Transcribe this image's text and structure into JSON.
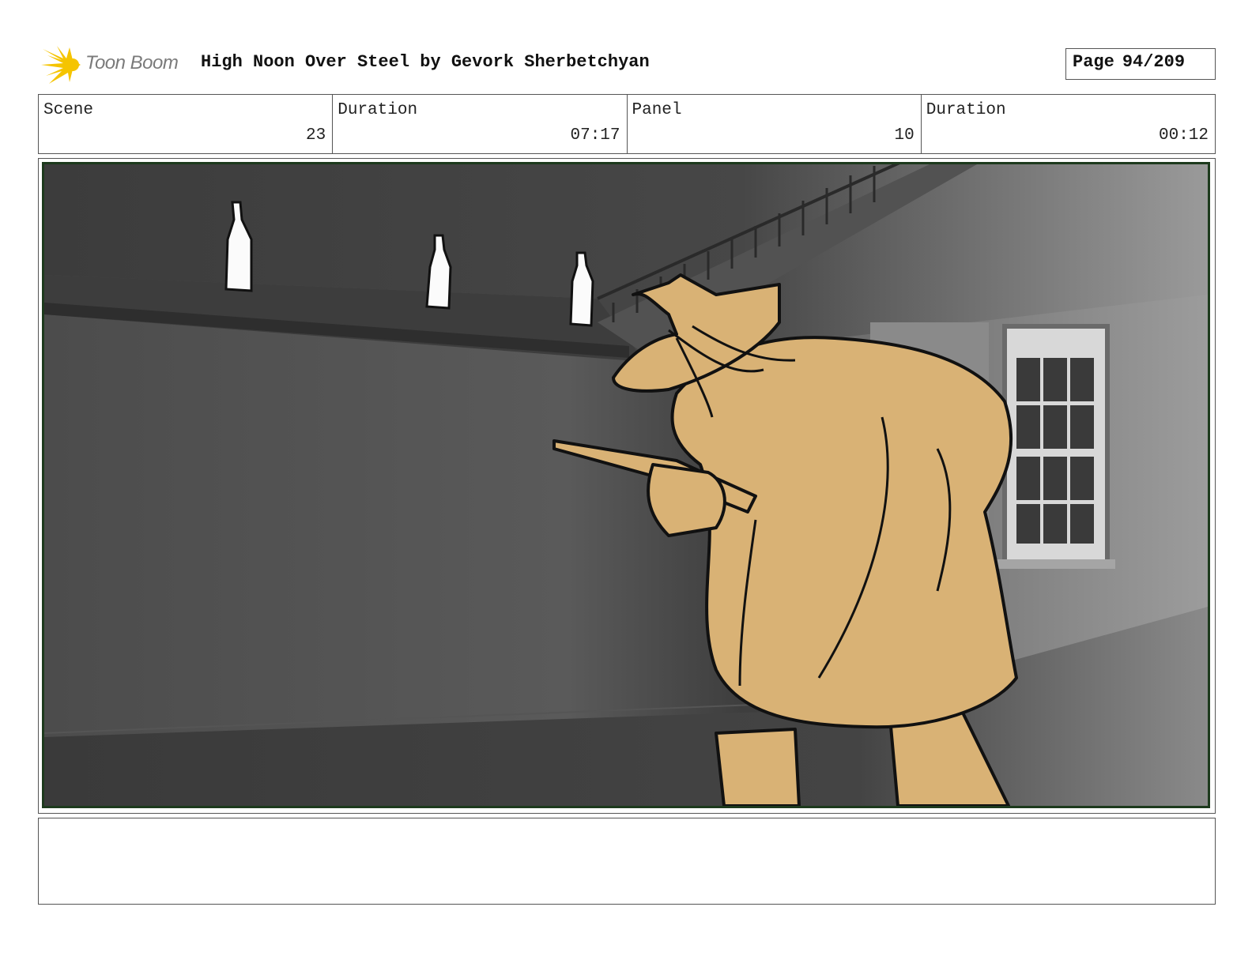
{
  "header": {
    "logo_text": "Toon Boom",
    "title": "High Noon Over Steel by Gevork Sherbetchyan",
    "page_label": "Page",
    "page_value": "94/209"
  },
  "info": {
    "scene_label": "Scene",
    "scene_value": "23",
    "scene_duration_label": "Duration",
    "scene_duration_value": "07:17",
    "panel_label": "Panel",
    "panel_value": "10",
    "panel_duration_label": "Duration",
    "panel_duration_value": "00:12"
  },
  "colors": {
    "logo_accent": "#f5c400",
    "frame_border": "#1d3a1d",
    "character_fill": "#d9b275"
  },
  "notes": {
    "text": ""
  }
}
